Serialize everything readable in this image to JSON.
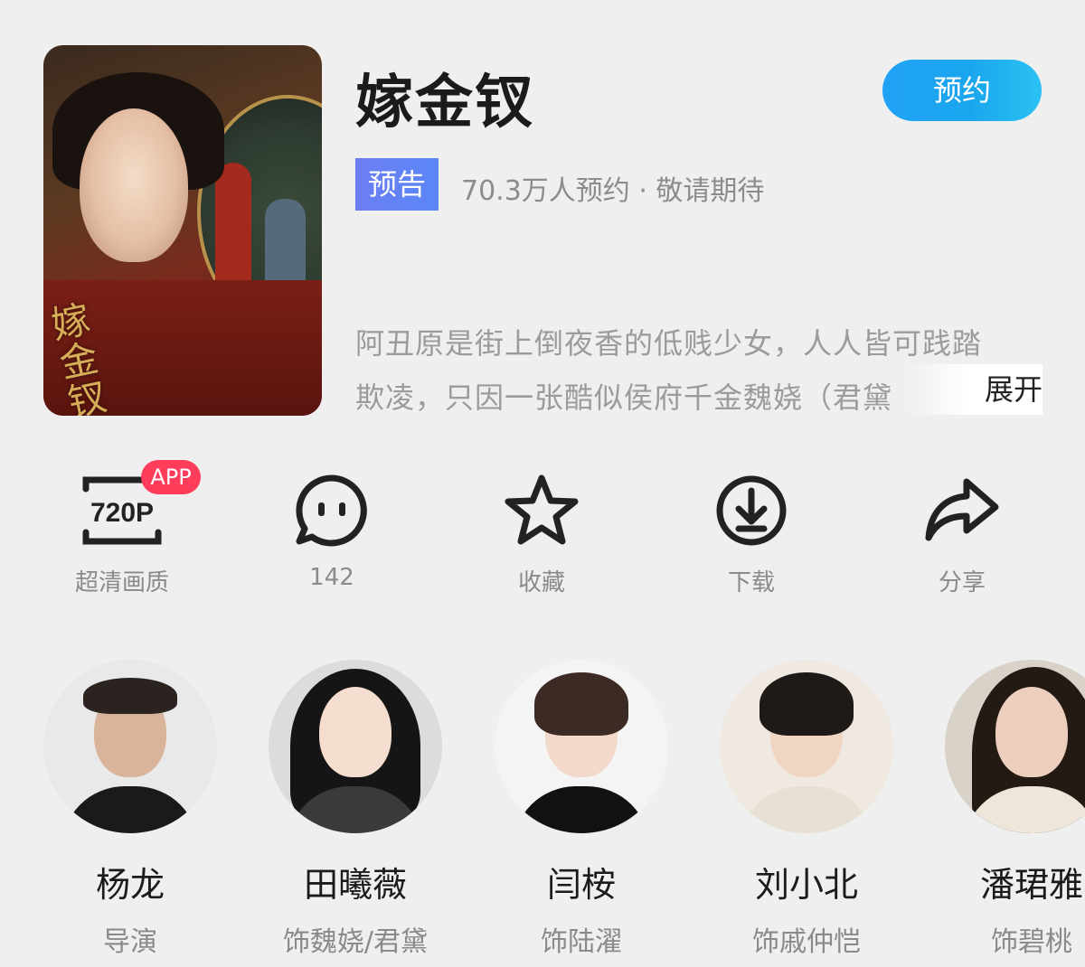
{
  "header": {
    "title": "嫁金钗",
    "reserve_label": "预约",
    "tag": "预告",
    "subinfo": "70.3万人预约 · 敬请期待",
    "poster_text": "嫁金钗"
  },
  "description": {
    "line1": "阿丑原是街上倒夜香的低贱少女，人人皆可践踏",
    "line2": "欺凌，只因一张酷似侯府千金魏娆（君黛",
    "expand_label": "展开"
  },
  "actions": [
    {
      "icon": "hd-720p-icon",
      "label": "超清画质",
      "icon_text": "720P",
      "badge": "APP"
    },
    {
      "icon": "comment-icon",
      "label": "142"
    },
    {
      "icon": "star-icon",
      "label": "收藏"
    },
    {
      "icon": "download-icon",
      "label": "下载"
    },
    {
      "icon": "share-icon",
      "label": "分享"
    }
  ],
  "cast": [
    {
      "name": "杨龙",
      "role": "导演"
    },
    {
      "name": "田曦薇",
      "role": "饰魏娆/君黛"
    },
    {
      "name": "闫桉",
      "role": "饰陆濯"
    },
    {
      "name": "刘小北",
      "role": "饰戚仲恺"
    },
    {
      "name": "潘珺雅",
      "role": "饰碧桃"
    }
  ],
  "colors": {
    "accent": "#1aa6ee",
    "tag": "#6c7ef3",
    "badge": "#ff3d5a"
  }
}
